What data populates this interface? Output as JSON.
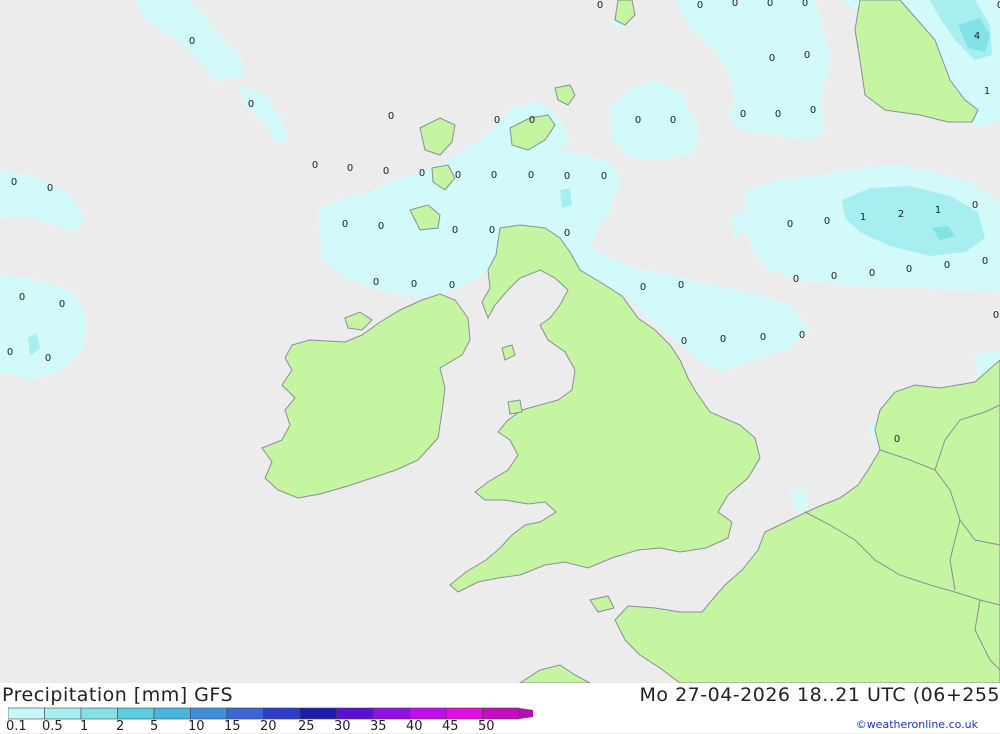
{
  "footer": {
    "title": "Precipitation [mm] GFS",
    "datetime": "Mo 27-04-2026 18..21 UTC (06+255",
    "credit": "©weatheronline.co.uk"
  },
  "legend": {
    "labels": [
      "0.1",
      "0.5",
      "1",
      "2",
      "5",
      "10",
      "15",
      "20",
      "25",
      "30",
      "35",
      "40",
      "45",
      "50"
    ],
    "colors": [
      "#c8f7f7",
      "#a6eef0",
      "#82e2e6",
      "#5ccdde",
      "#48b4e0",
      "#3c8fdc",
      "#3a66d6",
      "#2e3fc6",
      "#1d1ea8",
      "#5a10d0",
      "#9210e0",
      "#bf10e6",
      "#e010e0",
      "#c010c0"
    ]
  },
  "map": {
    "colors": {
      "sea": "#ececec",
      "land": "#c5f5a0",
      "border": "#8c8c9c",
      "precip_light": "#d2fafa",
      "precip_mid": "#a6eef0",
      "precip_heavy": "#82e2e6"
    },
    "values": [
      "0",
      "0",
      "0",
      "0",
      "0",
      "0",
      "0",
      "0",
      "0",
      "0",
      "0",
      "0",
      "0",
      "0",
      "0",
      "0",
      "0",
      "0",
      "0",
      "0",
      "0",
      "0",
      "0",
      "0",
      "0",
      "0",
      "0",
      "0",
      "0",
      "0",
      "0",
      "0",
      "0",
      "0",
      "0",
      "0",
      "0",
      "0",
      "0",
      "0",
      "0",
      "0",
      "0",
      "0",
      "0",
      "0",
      "0",
      "0",
      "0",
      "0",
      "0",
      "0",
      "0",
      "0",
      "0",
      "0",
      "1",
      "2",
      "1",
      "0",
      "4",
      "1",
      "0"
    ]
  }
}
